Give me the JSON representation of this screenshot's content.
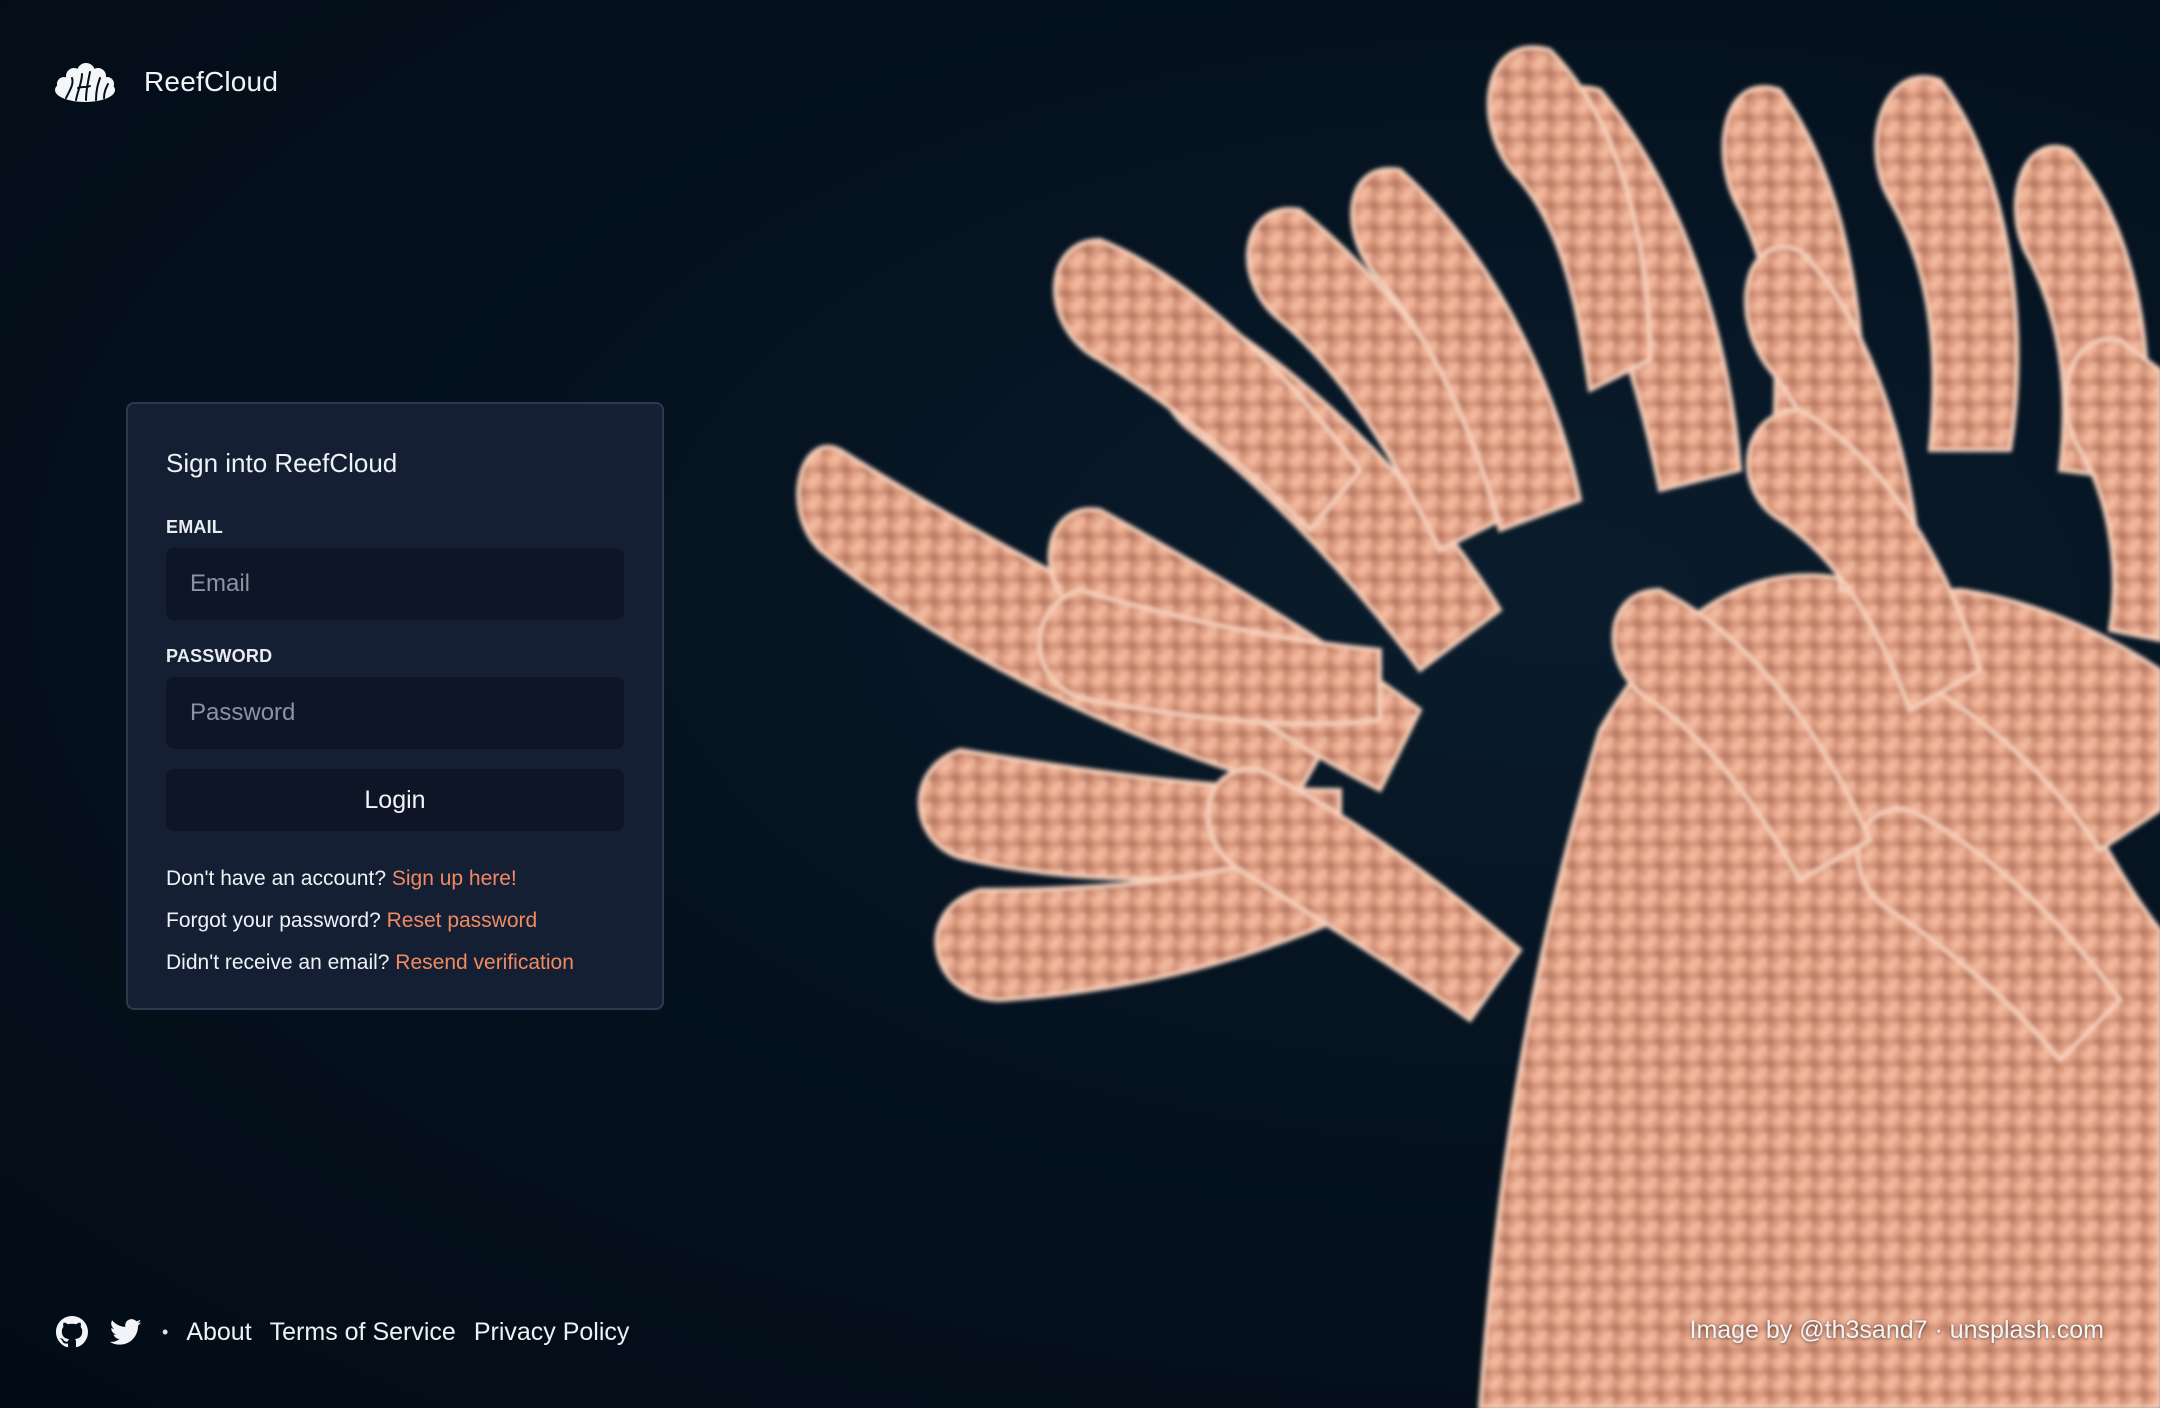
{
  "header": {
    "app_name": "ReefCloud",
    "logo_icon": "coral-logo-icon"
  },
  "login_card": {
    "title": "Sign into ReefCloud",
    "email_label": "EMAIL",
    "email_placeholder": "Email",
    "email_value": "",
    "password_label": "PASSWORD",
    "password_placeholder": "Password",
    "password_value": "",
    "login_button": "Login",
    "signup_prompt": "Don't have an account?",
    "signup_link": "Sign up here!",
    "forgot_prompt": "Forgot your password?",
    "reset_link": "Reset password",
    "resend_prompt": "Didn't receive an email?",
    "resend_link": "Resend verification"
  },
  "footer": {
    "icons": [
      "github-icon",
      "twitter-icon"
    ],
    "separator": "•",
    "links": [
      "About",
      "Terms of Service",
      "Privacy Policy"
    ],
    "credit": "Image by @th3sand7 · unsplash.com"
  },
  "colors": {
    "background": "#03111f",
    "card": "#141f33",
    "input": "#0e1526",
    "accent_link": "#f08a63",
    "coral": "#f3b39a"
  }
}
